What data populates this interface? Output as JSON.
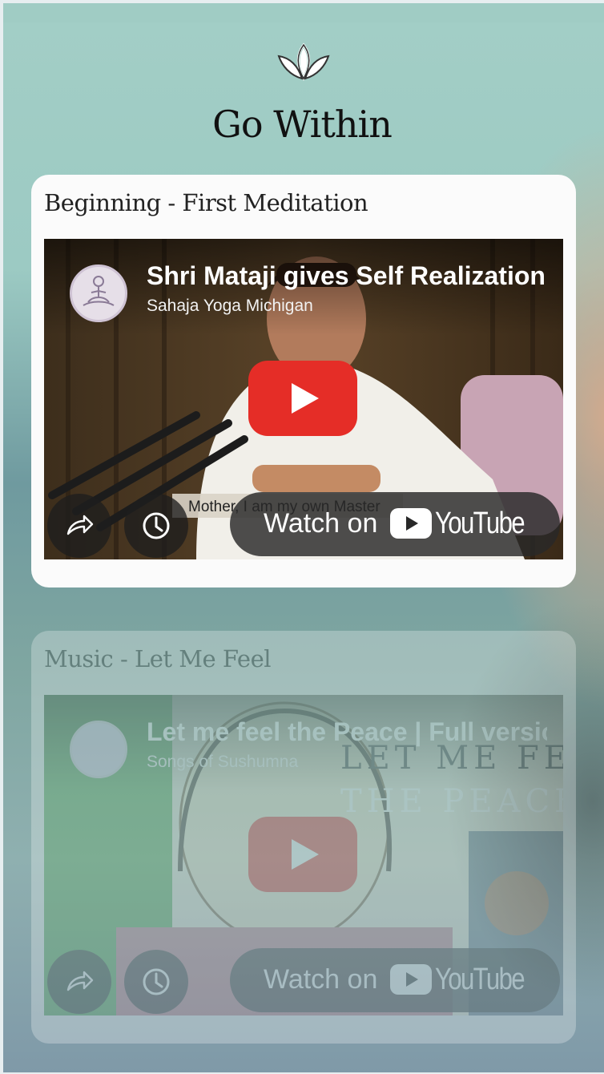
{
  "app": {
    "title": "Go Within",
    "logo_icon": "lotus-icon"
  },
  "cards": [
    {
      "title": "Beginning - First Meditation",
      "video": {
        "title": "Shri Mataji gives Self Realization",
        "channel": "Sahaja Yoga Michigan",
        "caption": "Mother, I am my own Master",
        "watch_label": "Watch on",
        "brand_label": "YouTube",
        "share_icon": "share-icon",
        "watch_later_icon": "clock-icon",
        "play_icon": "play-icon"
      }
    },
    {
      "title": "Music - Let Me Feel",
      "video": {
        "title": "Let me feel the Peace | Full version",
        "channel": "Songs of Sushumna",
        "thumbnail_text_line1": "LET ME FEEL",
        "thumbnail_text_line2": "THE PEACE",
        "watch_label": "Watch on",
        "brand_label": "YouTube",
        "share_icon": "share-icon",
        "watch_later_icon": "clock-icon",
        "play_icon": "play-icon"
      }
    }
  ],
  "colors": {
    "youtube_red": "#e52d27",
    "card_bg": "#fbfbfb",
    "teal_bg": "#9ccac3"
  }
}
